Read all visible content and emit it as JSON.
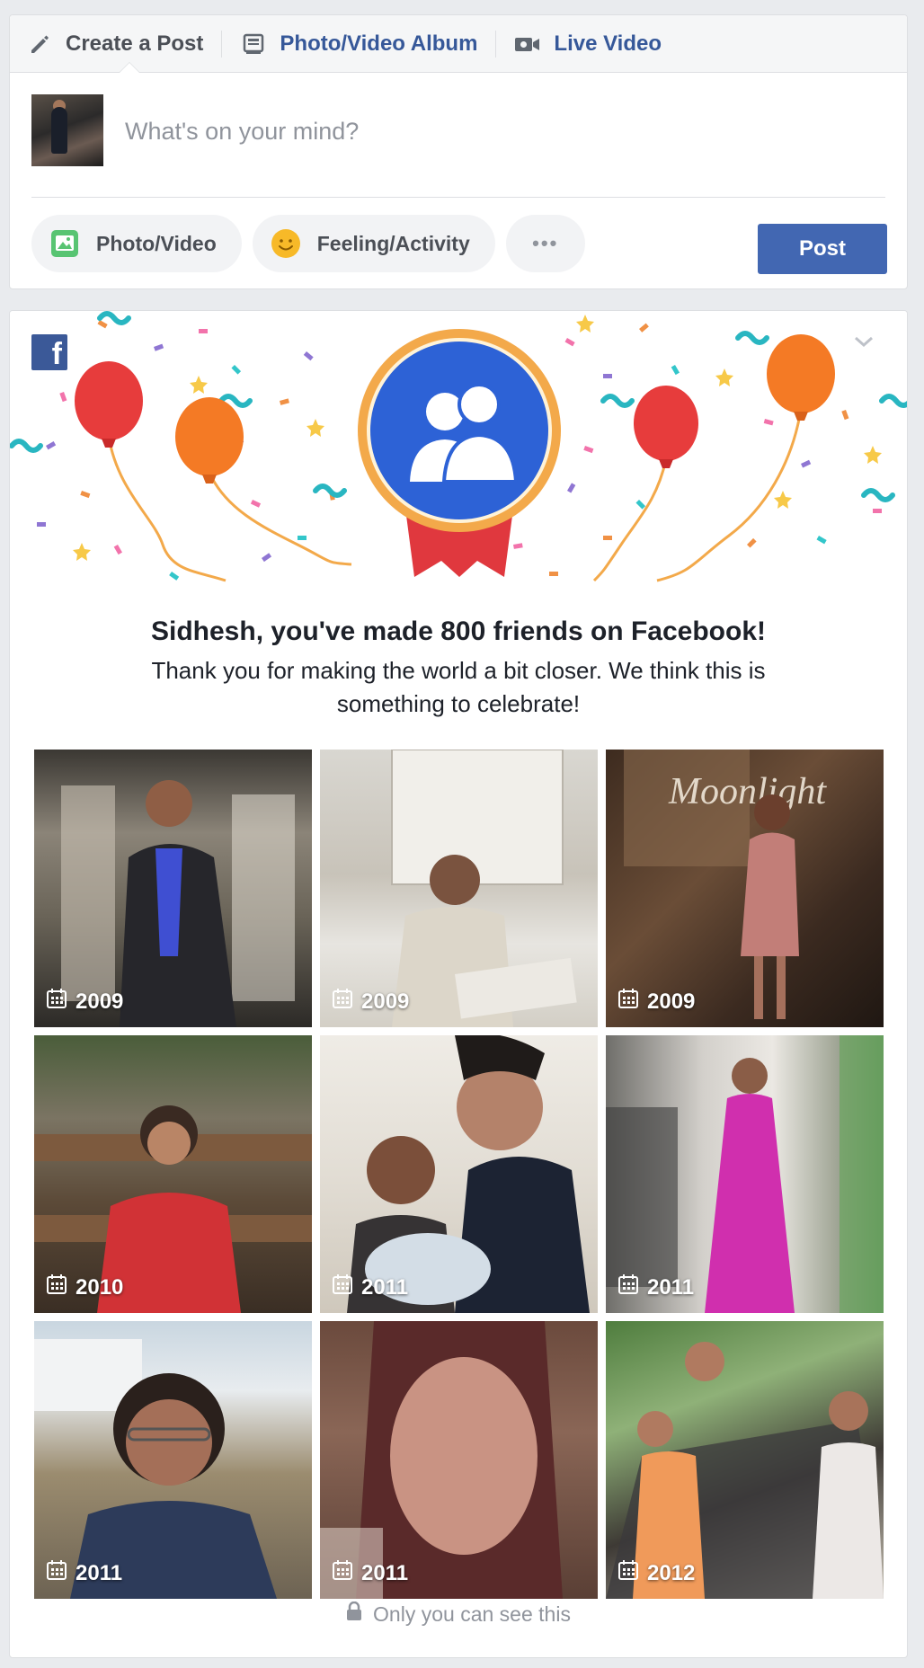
{
  "composer": {
    "tabs": [
      {
        "label": "Create a Post",
        "icon": "pencil-icon"
      },
      {
        "label": "Photo/Video Album",
        "icon": "album-icon"
      },
      {
        "label": "Live Video",
        "icon": "video-camera-icon"
      }
    ],
    "placeholder": "What's on your mind?",
    "actions": [
      {
        "label": "Photo/Video",
        "icon": "photo-icon"
      },
      {
        "label": "Feeling/Activity",
        "icon": "smiley-icon"
      },
      {
        "label": "•••",
        "icon": "more-icon"
      }
    ],
    "post_label": "Post"
  },
  "celebration": {
    "headline": "Sidhesh, you've made 800 friends on Facebook!",
    "message": "Thank you for making the world a bit closer. We think this is something to celebrate!",
    "photos": [
      {
        "year": "2009"
      },
      {
        "year": "2009"
      },
      {
        "year": "2009"
      },
      {
        "year": "2010"
      },
      {
        "year": "2011"
      },
      {
        "year": "2011"
      },
      {
        "year": "2011"
      },
      {
        "year": "2011"
      },
      {
        "year": "2012"
      }
    ],
    "privacy_note": "Only you can see this"
  },
  "colors": {
    "brand_blue": "#4267b2",
    "link_blue": "#365899",
    "page_bg": "#e9ebee",
    "medal_blue": "#2d62d6",
    "medal_ring": "#f3a94a",
    "ribbon_red": "#e0383e"
  }
}
